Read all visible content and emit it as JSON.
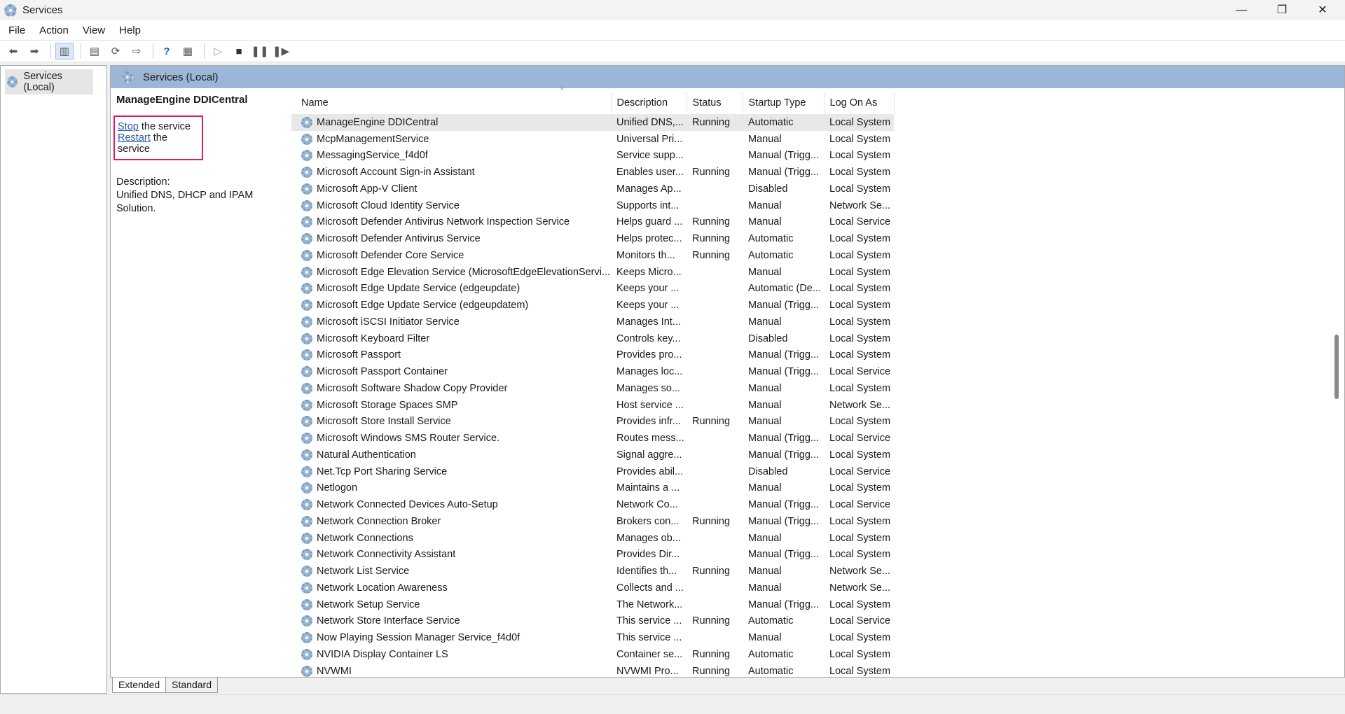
{
  "window": {
    "title": "Services",
    "min": "—",
    "max": "❐",
    "close": "✕"
  },
  "menu": [
    "File",
    "Action",
    "View",
    "Help"
  ],
  "tree": {
    "root": "Services (Local)"
  },
  "header": {
    "title": "Services (Local)"
  },
  "detail": {
    "service": "ManageEngine DDICentral",
    "stop_link": "Stop",
    "stop_rest": " the service",
    "restart_link": "Restart",
    "restart_rest": " the service",
    "desc_label": "Description:",
    "desc_text": "Unified DNS, DHCP and IPAM Solution."
  },
  "columns": [
    "Name",
    "Description",
    "Status",
    "Startup Type",
    "Log On As"
  ],
  "rows": [
    [
      "ManageEngine DDICentral",
      "Unified DNS,...",
      "Running",
      "Automatic",
      "Local System"
    ],
    [
      "McpManagementService",
      "Universal Pri...",
      "",
      "Manual",
      "Local System"
    ],
    [
      "MessagingService_f4d0f",
      "Service supp...",
      "",
      "Manual (Trigg...",
      "Local System"
    ],
    [
      "Microsoft Account Sign-in Assistant",
      "Enables user...",
      "Running",
      "Manual (Trigg...",
      "Local System"
    ],
    [
      "Microsoft App-V Client",
      "Manages Ap...",
      "",
      "Disabled",
      "Local System"
    ],
    [
      "Microsoft Cloud Identity Service",
      "Supports int...",
      "",
      "Manual",
      "Network Se..."
    ],
    [
      "Microsoft Defender Antivirus Network Inspection Service",
      "Helps guard ...",
      "Running",
      "Manual",
      "Local Service"
    ],
    [
      "Microsoft Defender Antivirus Service",
      "Helps protec...",
      "Running",
      "Automatic",
      "Local System"
    ],
    [
      "Microsoft Defender Core Service",
      "Monitors th...",
      "Running",
      "Automatic",
      "Local System"
    ],
    [
      "Microsoft Edge Elevation Service (MicrosoftEdgeElevationServi...",
      "Keeps Micro...",
      "",
      "Manual",
      "Local System"
    ],
    [
      "Microsoft Edge Update Service (edgeupdate)",
      "Keeps your ...",
      "",
      "Automatic (De...",
      "Local System"
    ],
    [
      "Microsoft Edge Update Service (edgeupdatem)",
      "Keeps your ...",
      "",
      "Manual (Trigg...",
      "Local System"
    ],
    [
      "Microsoft iSCSI Initiator Service",
      "Manages Int...",
      "",
      "Manual",
      "Local System"
    ],
    [
      "Microsoft Keyboard Filter",
      "Controls key...",
      "",
      "Disabled",
      "Local System"
    ],
    [
      "Microsoft Passport",
      "Provides pro...",
      "",
      "Manual (Trigg...",
      "Local System"
    ],
    [
      "Microsoft Passport Container",
      "Manages loc...",
      "",
      "Manual (Trigg...",
      "Local Service"
    ],
    [
      "Microsoft Software Shadow Copy Provider",
      "Manages so...",
      "",
      "Manual",
      "Local System"
    ],
    [
      "Microsoft Storage Spaces SMP",
      "Host service ...",
      "",
      "Manual",
      "Network Se..."
    ],
    [
      "Microsoft Store Install Service",
      "Provides infr...",
      "Running",
      "Manual",
      "Local System"
    ],
    [
      "Microsoft Windows SMS Router Service.",
      "Routes mess...",
      "",
      "Manual (Trigg...",
      "Local Service"
    ],
    [
      "Natural Authentication",
      "Signal aggre...",
      "",
      "Manual (Trigg...",
      "Local System"
    ],
    [
      "Net.Tcp Port Sharing Service",
      "Provides abil...",
      "",
      "Disabled",
      "Local Service"
    ],
    [
      "Netlogon",
      "Maintains a ...",
      "",
      "Manual",
      "Local System"
    ],
    [
      "Network Connected Devices Auto-Setup",
      "Network Co...",
      "",
      "Manual (Trigg...",
      "Local Service"
    ],
    [
      "Network Connection Broker",
      "Brokers con...",
      "Running",
      "Manual (Trigg...",
      "Local System"
    ],
    [
      "Network Connections",
      "Manages ob...",
      "",
      "Manual",
      "Local System"
    ],
    [
      "Network Connectivity Assistant",
      "Provides Dir...",
      "",
      "Manual (Trigg...",
      "Local System"
    ],
    [
      "Network List Service",
      "Identifies th...",
      "Running",
      "Manual",
      "Network Se..."
    ],
    [
      "Network Location Awareness",
      "Collects and ...",
      "",
      "Manual",
      "Network Se..."
    ],
    [
      "Network Setup Service",
      "The Network...",
      "",
      "Manual (Trigg...",
      "Local System"
    ],
    [
      "Network Store Interface Service",
      "This service ...",
      "Running",
      "Automatic",
      "Local Service"
    ],
    [
      "Now Playing Session Manager Service_f4d0f",
      "This service ...",
      "",
      "Manual",
      "Local System"
    ],
    [
      "NVIDIA Display Container LS",
      "Container se...",
      "Running",
      "Automatic",
      "Local System"
    ],
    [
      "NVWMI",
      "NVWMI Pro...",
      "Running",
      "Automatic",
      "Local System"
    ]
  ],
  "tabs": [
    "Extended",
    "Standard"
  ]
}
